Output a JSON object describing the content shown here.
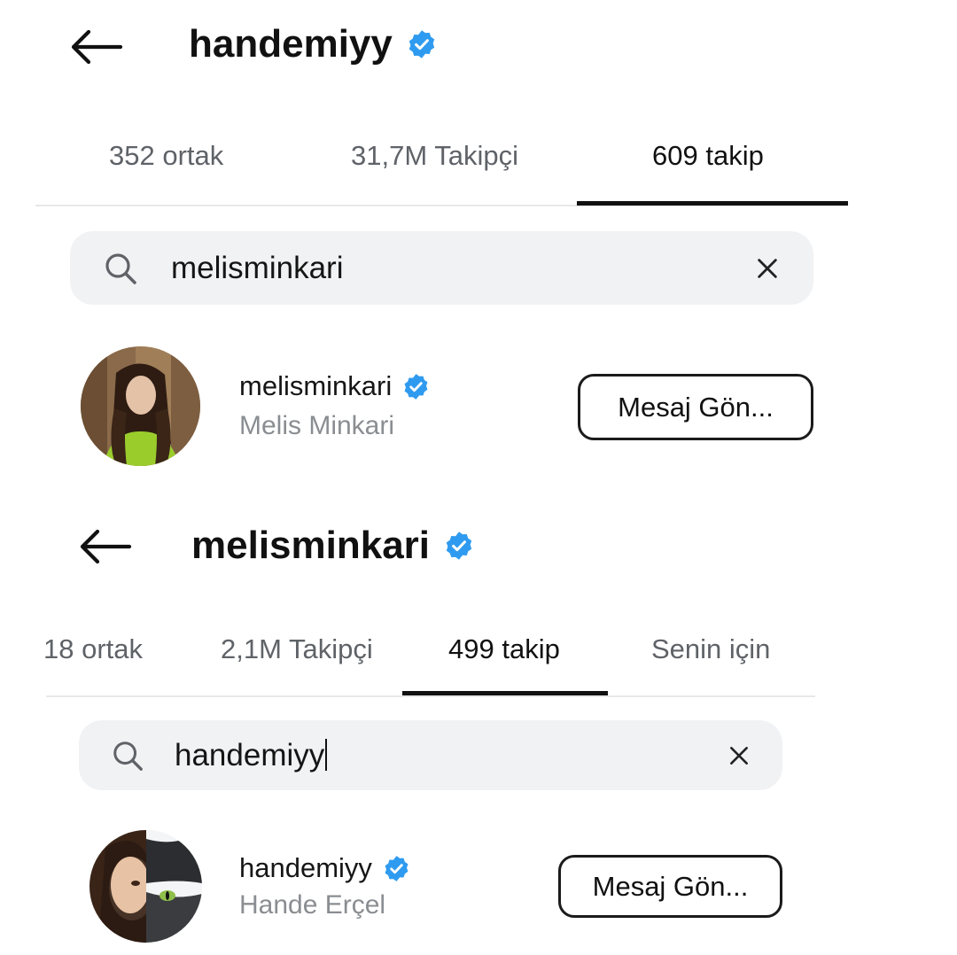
{
  "colors": {
    "verified": "#2f9bf0",
    "text": "#111111",
    "muted": "#8a8d91",
    "search_bg": "#f1f2f4"
  },
  "panels": [
    {
      "title": "handemiyy",
      "tabs": [
        {
          "label": "352 ortak"
        },
        {
          "label": "31,7M Takipçi"
        },
        {
          "label": "609 takip",
          "active": true
        }
      ],
      "search": {
        "icon": "search-icon",
        "value": "melisminkari",
        "clear_icon": "close-icon"
      },
      "result": {
        "handle": "melisminkari",
        "name": "Melis Minkari",
        "button": "Mesaj Gön..."
      }
    },
    {
      "title": "melisminkari",
      "tabs": [
        {
          "label": "18 ortak"
        },
        {
          "label": "2,1M Takipçi"
        },
        {
          "label": "499 takip",
          "active": true
        },
        {
          "label": "Senin için"
        }
      ],
      "search": {
        "icon": "search-icon",
        "value": "handemiyy",
        "clear_icon": "close-icon"
      },
      "result": {
        "handle": "handemiyy",
        "name": "Hande Erçel",
        "button": "Mesaj Gön..."
      }
    }
  ]
}
